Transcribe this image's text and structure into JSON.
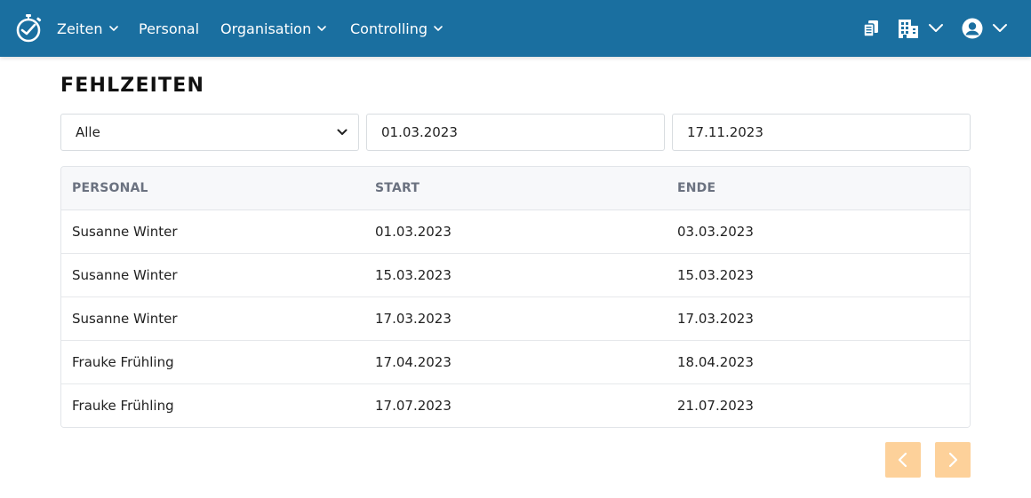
{
  "nav": {
    "items": [
      {
        "label": "Zeiten",
        "has_dropdown": true
      },
      {
        "label": "Personal",
        "has_dropdown": false
      },
      {
        "label": "Organisation",
        "has_dropdown": true
      },
      {
        "label": "Controlling",
        "has_dropdown": true
      }
    ],
    "right_icons": [
      "documents-icon",
      "building-icon",
      "user-account-icon"
    ],
    "background_color": "#1a6fa0"
  },
  "page": {
    "title": "FEHLZEITEN"
  },
  "filters": {
    "staff_select": {
      "selected": "Alle"
    },
    "date_from": {
      "value": "01.03.2023"
    },
    "date_to": {
      "value": "17.11.2023"
    }
  },
  "table": {
    "headers": [
      "PERSONAL",
      "START",
      "ENDE"
    ],
    "rows": [
      [
        "Susanne Winter",
        "01.03.2023",
        "03.03.2023"
      ],
      [
        "Susanne Winter",
        "15.03.2023",
        "15.03.2023"
      ],
      [
        "Susanne Winter",
        "17.03.2023",
        "17.03.2023"
      ],
      [
        "Frauke Frühling",
        "17.04.2023",
        "18.04.2023"
      ],
      [
        "Frauke Frühling",
        "17.07.2023",
        "21.07.2023"
      ]
    ]
  },
  "pagination": {
    "button_color": "#fdd19a",
    "prev_icon": "chevron-left-icon",
    "next_icon": "chevron-right-icon"
  }
}
